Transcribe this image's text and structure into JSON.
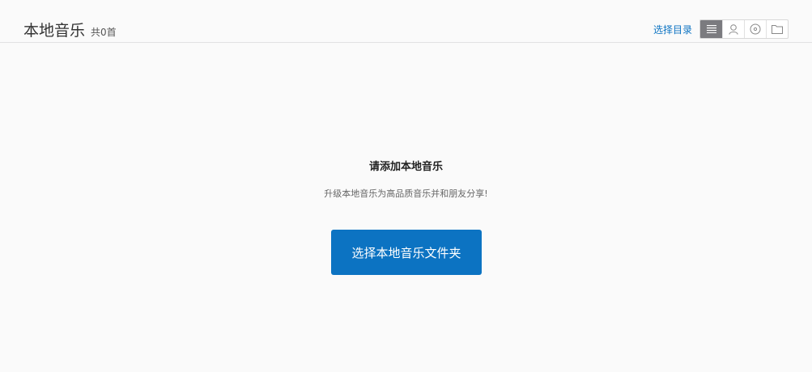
{
  "header": {
    "title": "本地音乐",
    "count": "共0首",
    "choose_dir": "选择目录",
    "views": [
      {
        "icon": "list-icon",
        "active": true
      },
      {
        "icon": "user-icon",
        "active": false
      },
      {
        "icon": "disc-icon",
        "active": false
      },
      {
        "icon": "folder-icon",
        "active": false
      }
    ]
  },
  "empty": {
    "title": "请添加本地音乐",
    "subtitle": "升级本地音乐为高品质音乐并和朋友分享!",
    "button_label": "选择本地音乐文件夹"
  },
  "colors": {
    "accent": "#0c73c2",
    "active_view": "#7b7b7f",
    "background": "#fafafa"
  }
}
